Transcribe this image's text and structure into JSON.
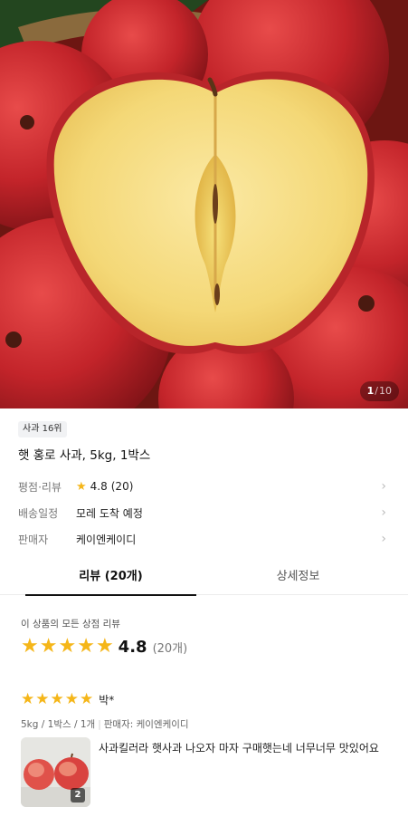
{
  "gallery": {
    "current": "1",
    "separator": "/",
    "total": "10"
  },
  "product": {
    "rank_badge": "사과 16위",
    "title": "햇 홍로 사과, 5kg, 1박스"
  },
  "info": {
    "rating_label": "평점·리뷰",
    "rating_value": "4.8",
    "rating_count": "(20)",
    "delivery_label": "배송일정",
    "delivery_value": "모레 도착 예정",
    "seller_label": "판매자",
    "seller_value": "케이엔케이디"
  },
  "tabs": {
    "reviews": "리뷰 (20개)",
    "details": "상세정보"
  },
  "review_summary": {
    "caption": "이 상품의 모든 상점 리뷰",
    "stars": 5,
    "score": "4.8",
    "count": "(20개)"
  },
  "review": {
    "stars": 5,
    "reviewer": "박*",
    "option": "5kg / 1박스 / 1개",
    "seller": "판매자: 케이엔케이디",
    "photo_count": "2",
    "text": "사과킬러라 햇사과 나오자 마자 구매햇는네 너무너무 맛있어요"
  },
  "colors": {
    "star": "#f5b619",
    "apple_skin": "#c8262b",
    "apple_flesh": "#f7e39a"
  }
}
